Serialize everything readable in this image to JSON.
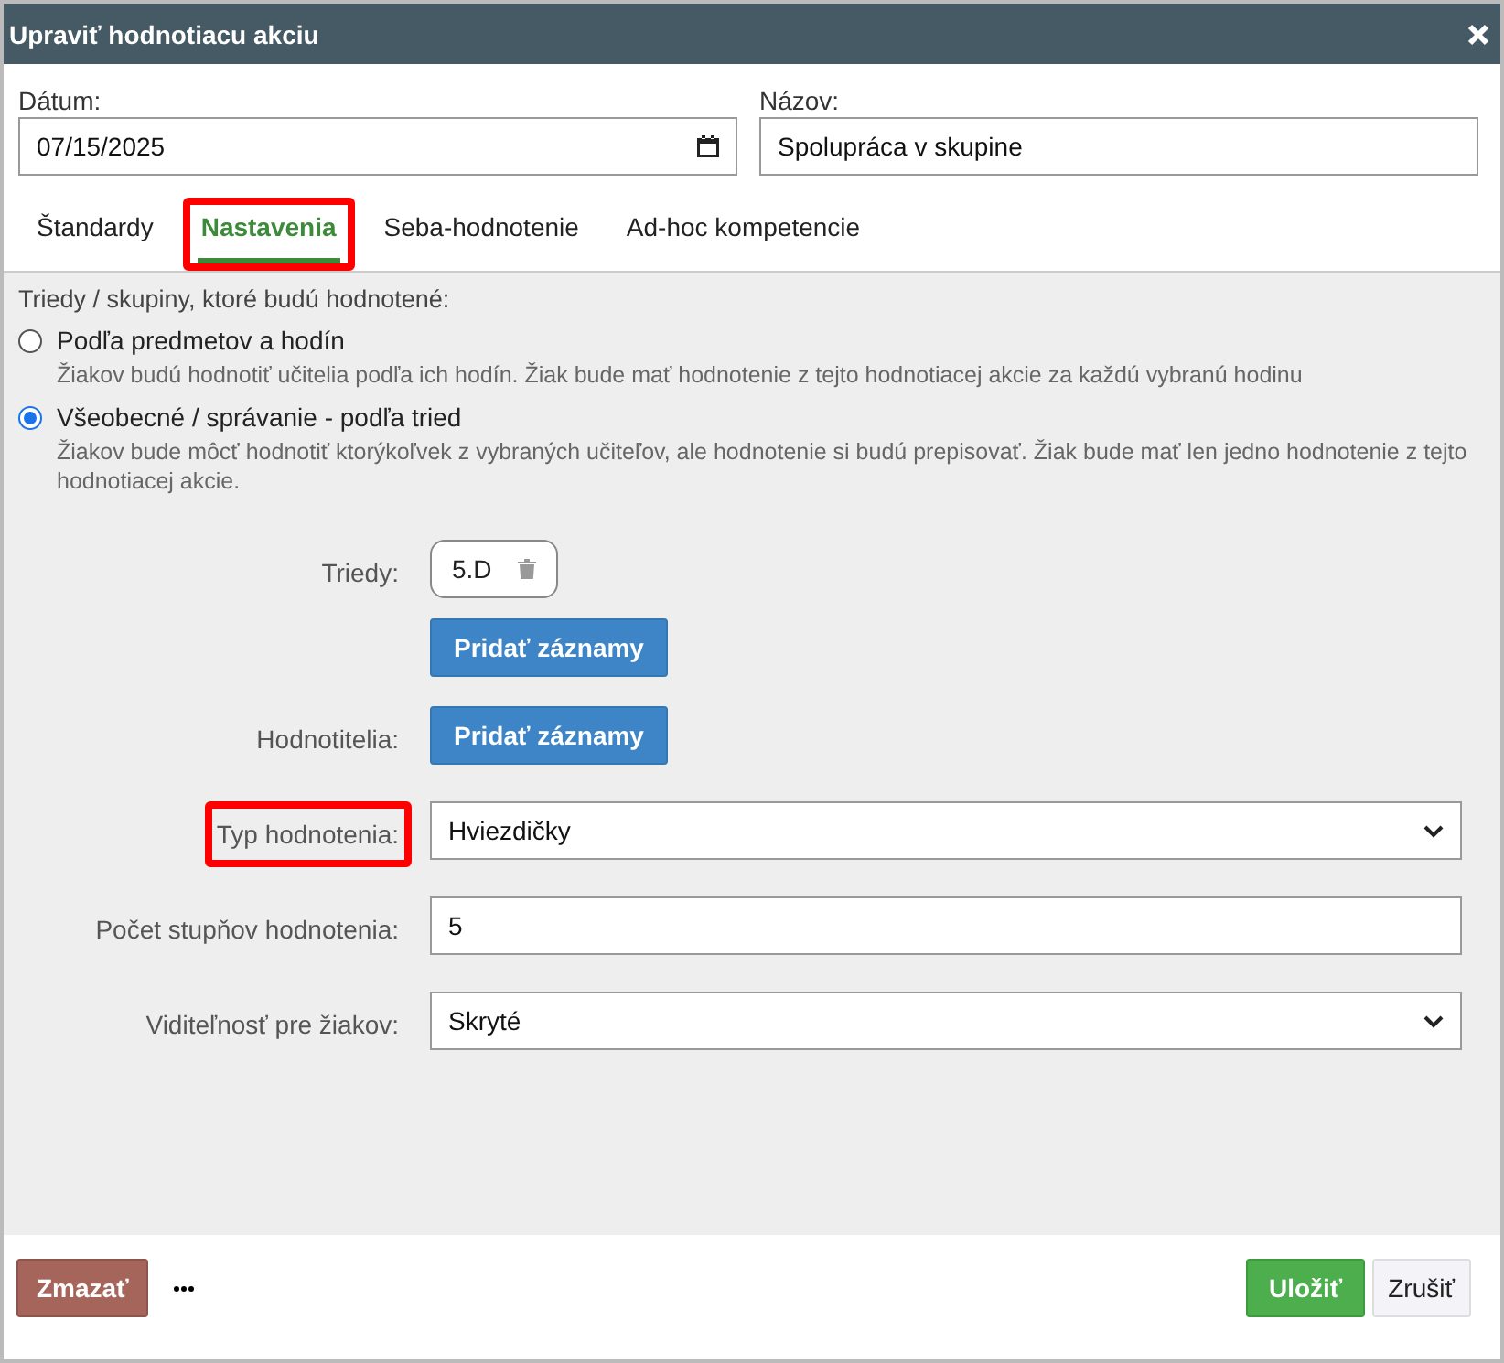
{
  "window": {
    "title": "Upraviť hodnotiacu akciu"
  },
  "date": {
    "label": "Dátum:",
    "value": "07/15/2025"
  },
  "name": {
    "label": "Názov:",
    "value": "Spolupráca v skupine"
  },
  "tabs": [
    {
      "label": "Štandardy",
      "selected": false,
      "highlighted": false
    },
    {
      "label": "Nastavenia",
      "selected": true,
      "highlighted": true
    },
    {
      "label": "Seba-hodnotenie",
      "selected": false,
      "highlighted": false
    },
    {
      "label": "Ad-hoc kompetencie",
      "selected": false,
      "highlighted": false
    }
  ],
  "groups": {
    "label": "Triedy / skupiny, ktoré budú hodnotené:",
    "options": [
      {
        "label": "Podľa predmetov a hodín",
        "description": "Žiakov budú hodnotiť učitelia podľa ich hodín. Žiak bude mať hodnotenie z tejto hodnotiacej akcie za každú vybranú hodinu",
        "selected": false
      },
      {
        "label": "Všeobecné / správanie - podľa tried",
        "description": "Žiakov bude môcť hodnotiť ktorýkoľvek z vybraných učiteľov, ale hodnotenie si budú prepisovať. Žiak bude mať len jedno hodnotenie z tejto hodnotiacej akcie.",
        "selected": true
      }
    ]
  },
  "form": [
    {
      "kind": "tags",
      "label": "Triedy:",
      "highlighted": false,
      "tags": [
        "5.D"
      ],
      "button": "Pridať záznamy"
    },
    {
      "kind": "button",
      "label": "Hodnotitelia:",
      "highlighted": false,
      "button": "Pridať záznamy"
    },
    {
      "kind": "select",
      "label": "Typ hodnotenia:",
      "highlighted": true,
      "value": "Hviezdičky"
    },
    {
      "kind": "text",
      "label": "Počet stupňov hodnotenia:",
      "highlighted": false,
      "value": "5"
    },
    {
      "kind": "select",
      "label": "Viditeľnosť pre žiakov:",
      "highlighted": false,
      "value": "Skryté"
    }
  ],
  "footer": {
    "delete": "Zmazať",
    "save": "Uložiť",
    "cancel": "Zrušiť"
  }
}
